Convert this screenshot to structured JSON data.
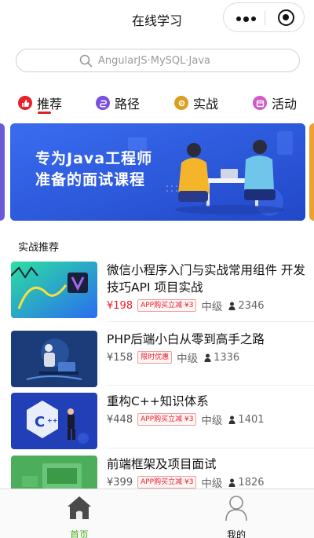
{
  "topbar": {
    "title": "在线学习",
    "more_icon": "more-dots-icon",
    "close_icon": "target-close-icon"
  },
  "search": {
    "placeholder": "AngularJS·MySQL·Java",
    "icon": "search-icon"
  },
  "tabs": [
    {
      "label": "推荐",
      "icon": "thumbs-up-icon",
      "color": "#e8202a",
      "active": true
    },
    {
      "label": "路径",
      "icon": "path-icon",
      "color": "#7b4fe0",
      "active": false
    },
    {
      "label": "实战",
      "icon": "shield-icon",
      "color": "#d9a023",
      "active": false
    },
    {
      "label": "活动",
      "icon": "calendar-icon",
      "color": "#d05ac8",
      "active": false
    }
  ],
  "banner": {
    "line1": "专为Java工程师",
    "line2": "准备的面试课程"
  },
  "section": {
    "title": "实战推荐"
  },
  "courses": [
    {
      "title": "微信小程序入门与实战常用组件 开发技巧API 项目实战",
      "price": "¥198",
      "price_style": "red",
      "badge": "APP购买立减 ¥3",
      "level": "中级",
      "students": "2346"
    },
    {
      "title": "PHP后端小白从零到高手之路",
      "price": "¥158",
      "price_style": "gray",
      "badge": "限时优惠",
      "level": "中级",
      "students": "1336"
    },
    {
      "title": "重构C++知识体系",
      "price": "¥448",
      "price_style": "gray",
      "badge": "APP购买立减 ¥3",
      "level": "中级",
      "students": "1401"
    },
    {
      "title": "前端框架及项目面试",
      "price": "¥399",
      "price_style": "gray",
      "badge": "APP购买立减 ¥3",
      "level": "中级",
      "students": "1826"
    }
  ],
  "tabbar": {
    "home": {
      "label": "首页",
      "icon": "home-icon",
      "color": "#4caf1a"
    },
    "me": {
      "label": "我的",
      "icon": "user-icon",
      "color": "#111111"
    }
  },
  "colors": {
    "accent": "#e8202a",
    "banner_bg": "#2d5ee6",
    "active_tab": "#4caf1a"
  }
}
